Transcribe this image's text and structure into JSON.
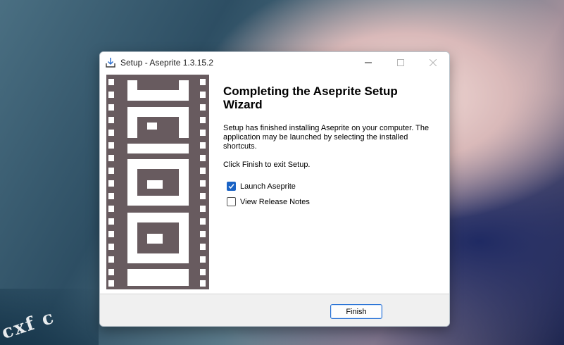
{
  "window": {
    "title": "Setup - Aseprite 1.3.15.2",
    "controls": {
      "minimize": "–",
      "maximize": "☐",
      "close": "✕"
    }
  },
  "wizard": {
    "heading": "Completing the Aseprite Setup Wizard",
    "message": "Setup has finished installing Aseprite on your computer. The application may be launched by selecting the installed shortcuts.",
    "instruction": "Click Finish to exit Setup.",
    "options": [
      {
        "label": "Launch Aseprite",
        "checked": true
      },
      {
        "label": "View Release Notes",
        "checked": false
      }
    ]
  },
  "footer": {
    "finish_label": "Finish"
  },
  "wallpaper": {
    "corner_text": "cxf c"
  },
  "colors": {
    "banner": "#685b5f",
    "accent": "#1a63c5"
  }
}
